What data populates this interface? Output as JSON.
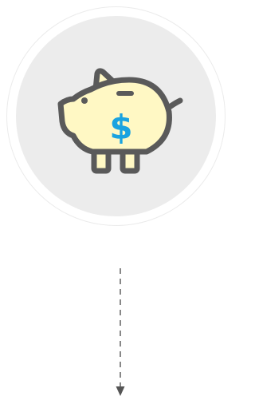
{
  "illustration": {
    "icon": "piggy-bank-icon",
    "symbol": "$",
    "colors": {
      "body_fill": "#fff8c4",
      "outline": "#5a5a5a",
      "dollar": "#1aa3e0",
      "disc": "#ececec",
      "ring_border": "#ebebeb"
    }
  },
  "connector": {
    "icon": "arrow-down-icon",
    "style": "dashed",
    "color": "#555555"
  }
}
